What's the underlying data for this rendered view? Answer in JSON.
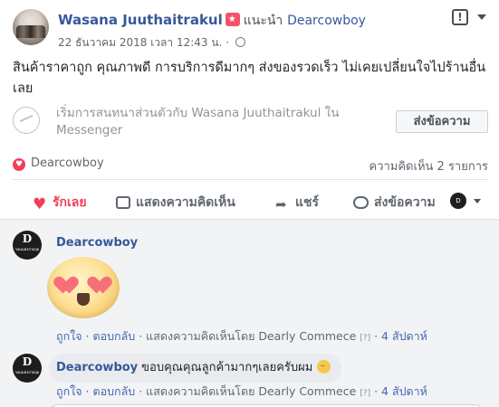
{
  "post": {
    "author": "Wasana Juuthaitrakul",
    "recommends_label": "แนะนำ",
    "recommended_page": "Dearcowboy",
    "date": "22 ธันวาคม 2018 เวลา 12:43 น.",
    "separator": "·",
    "body": "สินค้าราคาถูก คุณภาพดี การบริการดีมากๆ ส่งของรวดเร็ว ไม่เคยเปลี่ยนใจไปร้านอื่นเลย",
    "report_icon_glyph": "!"
  },
  "messenger": {
    "prompt": "เริ่มการสนทนาส่วนตัวกับ Wasana Juuthaitrakul ใน Messenger",
    "button_label": "ส่งข้อความ"
  },
  "reactions": {
    "reactor": "Dearcowboy",
    "comment_count_text": "ความคิดเห็น 2 รายการ"
  },
  "actions": {
    "love": "รักเลย",
    "comment": "แสดงความคิดเห็น",
    "share": "แชร์",
    "send": "ส่งข้อความ"
  },
  "comments": [
    {
      "author": "Dearcowboy",
      "sticker": "heart-eyes-face",
      "like": "ถูกใจ",
      "reply": "ตอบกลับ",
      "attribution": "แสดงความคิดเห็นโดย Dearly Commece",
      "help": "[?]",
      "time": "4 สัปดาห์"
    },
    {
      "author": "Dearcowboy",
      "text": "ขอบคุณคุณลูกค้ามากๆเลยครับผม",
      "like": "ถูกใจ",
      "reply": "ตอบกลับ",
      "attribution": "แสดงความคิดเห็นโดย Dearly Commece",
      "help": "[?]",
      "time": "4 สัปดาห์"
    }
  ],
  "page_avatar_text": {
    "initial": "D",
    "tagline": "ของแต่งสายลุย"
  },
  "colors": {
    "link": "#365899",
    "love": "#f33e58",
    "muted": "#616770",
    "comment_bg": "#f2f3f5"
  }
}
